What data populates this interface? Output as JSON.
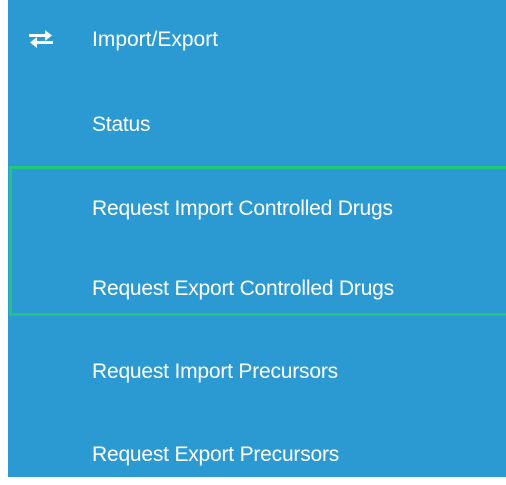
{
  "menu": {
    "header": {
      "icon": "transfer-arrows-icon",
      "label": "Import/Export"
    },
    "items": [
      {
        "label": "Status"
      },
      {
        "label": "Request Import Controlled Drugs"
      },
      {
        "label": "Request Export Controlled Drugs"
      },
      {
        "label": "Request Import Precursors"
      },
      {
        "label": "Request Export Precursors"
      }
    ]
  },
  "colors": {
    "background": "#2b9ad3",
    "text": "#ffffff",
    "highlight_border": "#1fc77a"
  }
}
